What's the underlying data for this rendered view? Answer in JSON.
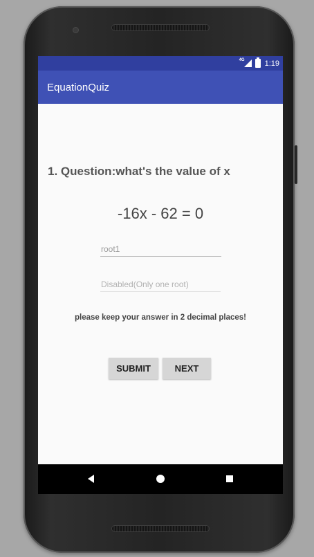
{
  "status_bar": {
    "network": "4G",
    "time": "1:19"
  },
  "app_bar": {
    "title": "EquationQuiz"
  },
  "quiz": {
    "question": "1. Question:what's the value of x",
    "equation": "-16x - 62 = 0",
    "root1": {
      "value": "",
      "placeholder": "root1"
    },
    "root2": {
      "value": "",
      "placeholder": "Disabled(Only one root)"
    },
    "hint": "please keep your answer in 2 decimal places!",
    "submit_label": "SUBMIT",
    "next_label": "NEXT"
  },
  "nav_bar": {
    "icons": [
      "back-icon",
      "home-icon",
      "recent-apps-icon"
    ]
  },
  "colors": {
    "status_bar": "#303f9f",
    "app_bar": "#3f51b5",
    "button": "#d6d6d6"
  }
}
